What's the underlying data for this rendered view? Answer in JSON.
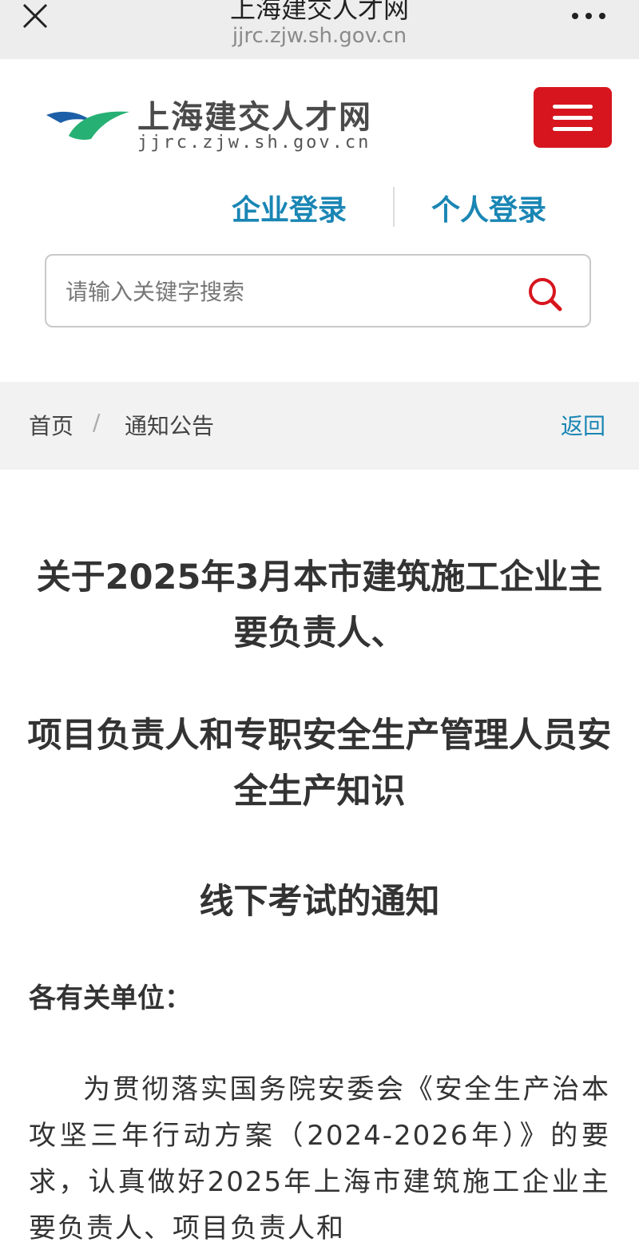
{
  "browser": {
    "title": "上海建交人才网",
    "url": "jjrc.zjw.sh.gov.cn",
    "close_icon": "close-icon",
    "more_icon": "more-icon"
  },
  "site": {
    "name": "上海建交人才网",
    "url": "jjrc.zjw.sh.gov.cn",
    "colors": {
      "brand_red": "#d7151e",
      "link_blue": "#1a86b4"
    }
  },
  "login": {
    "corporate": "企业登录",
    "personal": "个人登录"
  },
  "search": {
    "placeholder": "请输入关键字搜索"
  },
  "breadcrumb": {
    "home": "首页",
    "separator": "/",
    "current": "通知公告",
    "back": "返回"
  },
  "article": {
    "title_lines": [
      "关于2025年3月本市建筑施工企业主要负责人、",
      "项目负责人和专职安全生产管理人员安全生产知识",
      "线下考试的通知"
    ],
    "salutation": "各有关单位：",
    "paragraph": "为贯彻落实国务院安委会《安全生产治本攻坚三年行动方案（2024-2026年）》的要求，认真做好2025年上海市建筑施工企业主要负责人、项目负责人和"
  }
}
